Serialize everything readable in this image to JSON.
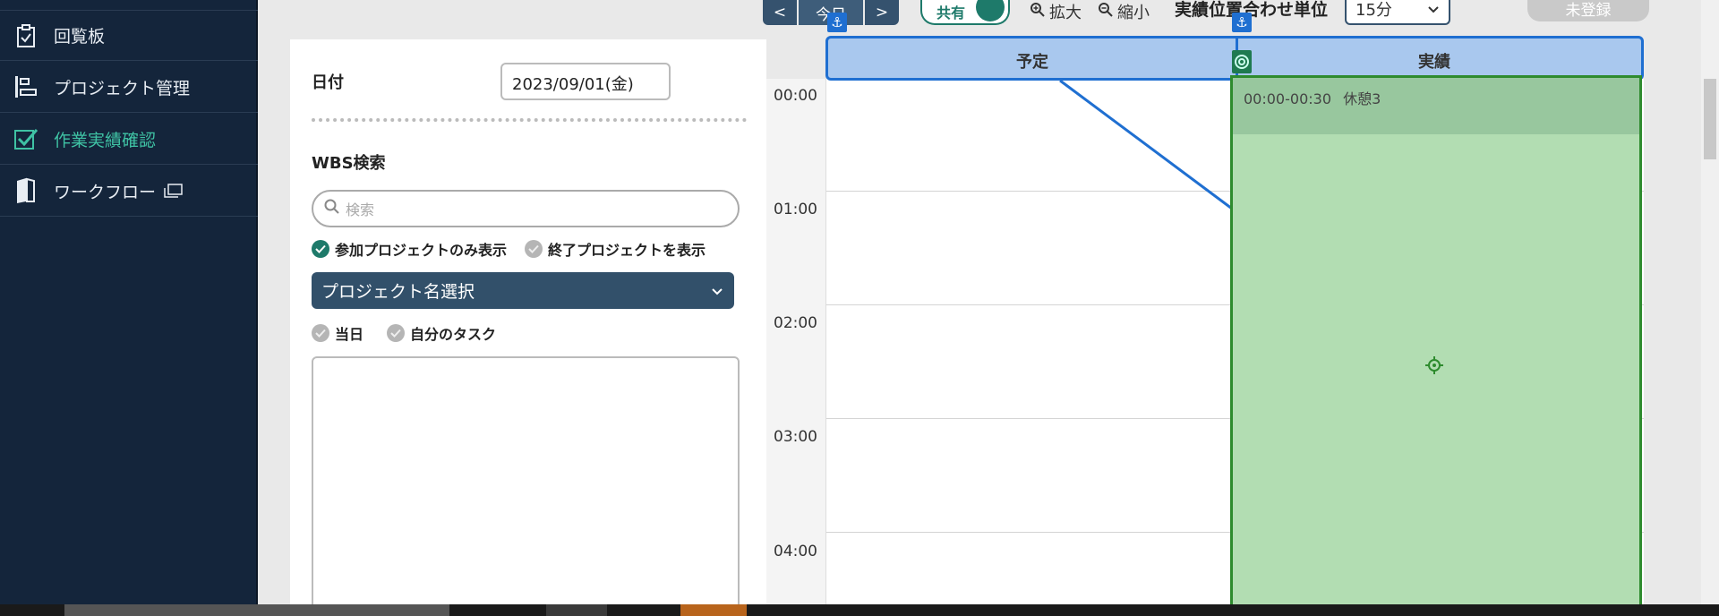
{
  "sidebar": {
    "items": [
      {
        "label": "回覧板",
        "icon": "clipboard-icon",
        "active": false
      },
      {
        "label": "プロジェクト管理",
        "icon": "gantt-icon",
        "active": false
      },
      {
        "label": "作業実績確認",
        "icon": "check-icon",
        "active": true
      },
      {
        "label": "ワークフロー",
        "icon": "book-icon",
        "active": false
      }
    ]
  },
  "form": {
    "date_label": "日付",
    "date_value": "2023/09/01(金)",
    "wbs_label": "WBS検索",
    "search_placeholder": "検索",
    "chk_joined_label": "参加プロジェクトのみ表示",
    "chk_ended_label": "終了プロジェクトを表示",
    "project_select_label": "プロジェクト名選択",
    "chk_today_label": "当日",
    "chk_mytask_label": "自分のタスク"
  },
  "toolbar": {
    "prev_label": "<",
    "today_label": "今日",
    "next_label": ">",
    "share_label": "共有",
    "zoom_in_label": "拡大",
    "zoom_out_label": "縮小",
    "unit_label": "実績位置合わせ単位",
    "unit_value": "15分",
    "unregistered_label": "未登録"
  },
  "calendar": {
    "plan_header": "予定",
    "actual_header": "実績",
    "hours": [
      "00:00",
      "01:00",
      "02:00",
      "03:00",
      "04:00"
    ],
    "event": {
      "time": "00:00-00:30",
      "title": "休憩3"
    }
  },
  "colors": {
    "sidebar_bg": "#14253b",
    "accent_teal": "#1e7a6a",
    "active_text": "#3fc2a4",
    "select_bg": "#32506a",
    "header_blue": "#1f6fd1",
    "actual_green": "#b2ddb2"
  }
}
